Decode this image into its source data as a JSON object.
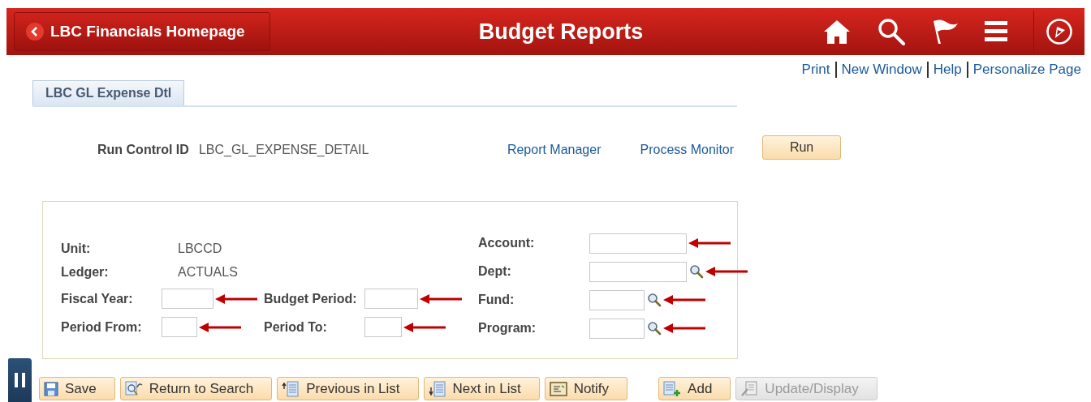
{
  "header": {
    "back_button": "LBC Financials Homepage",
    "title": "Budget Reports"
  },
  "page_links": [
    "Print",
    "New Window",
    "Help",
    "Personalize Page"
  ],
  "tabs": [
    {
      "label": "LBC GL Expense Dtl",
      "selected": true
    }
  ],
  "run_control": {
    "label": "Run Control ID",
    "value": "LBC_GL_EXPENSE_DETAIL",
    "links": [
      "Report Manager",
      "Process Monitor"
    ],
    "run_button": "Run"
  },
  "form": {
    "left_rows": [
      [
        {
          "kind": "display",
          "label": "Unit:",
          "value": "LBCCD"
        }
      ],
      [
        {
          "kind": "display",
          "label": "Ledger:",
          "value": "ACTUALS"
        }
      ],
      [
        {
          "kind": "input",
          "label": "Fiscal Year:",
          "arrow": true
        },
        {
          "kind": "input",
          "label": "Budget Period:",
          "arrow": true
        }
      ],
      [
        {
          "kind": "input",
          "label": "Period From:",
          "arrow": true
        },
        {
          "kind": "input",
          "label": "Period To:",
          "arrow": true
        }
      ]
    ],
    "right_rows": [
      {
        "kind": "input",
        "label": "Account:",
        "lookup": false,
        "arrow": true
      },
      {
        "kind": "input",
        "label": "Dept:",
        "lookup": true,
        "arrow": true
      },
      {
        "kind": "input",
        "label": "Fund:",
        "lookup": true,
        "arrow": true
      },
      {
        "kind": "input",
        "label": "Program:",
        "lookup": true,
        "arrow": true
      }
    ]
  },
  "toolbar": [
    {
      "kind": "save",
      "label": "Save",
      "disabled": false
    },
    {
      "kind": "return",
      "label": "Return to Search",
      "disabled": false
    },
    {
      "kind": "previous",
      "label": "Previous in List",
      "disabled": false
    },
    {
      "kind": "next",
      "label": "Next in List",
      "disabled": false
    },
    {
      "kind": "notify",
      "label": "Notify",
      "disabled": false
    },
    {
      "kind": "add",
      "label": "Add",
      "disabled": false
    },
    {
      "kind": "update",
      "label": "Update/Display",
      "disabled": true
    }
  ]
}
